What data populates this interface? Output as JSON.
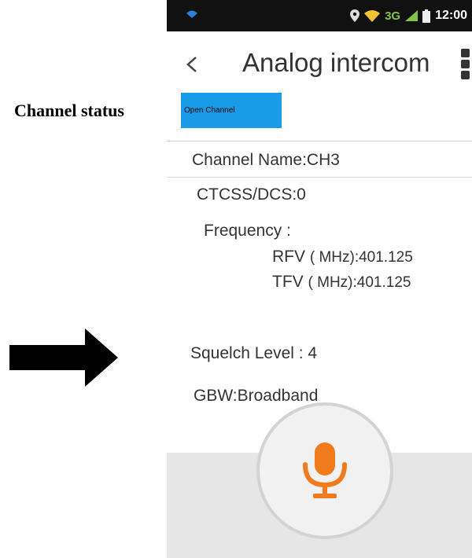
{
  "annotation": {
    "label": "Channel status"
  },
  "statusbar": {
    "network": "3G",
    "time": "12:00"
  },
  "header": {
    "back_icon": "chevron-left-icon",
    "title": "Analog intercom",
    "overflow_icon": "more-vert-icon"
  },
  "channel": {
    "open_button_label": "Open Channel",
    "name_line": "Channel Name:CH3",
    "ctcss_line": "CTCSS/DCS:0",
    "frequency_label": "Frequency :",
    "rfv_label": "RFV",
    "rfv_value": "( MHz):401.125",
    "tfv_label": "TFV",
    "tfv_value": "( MHz):401.125",
    "squelch_line": "Squelch Level : 4",
    "gbw_line": "GBW:Broadband"
  },
  "mic": {
    "icon": "microphone-icon",
    "accent_color": "#f07b1d"
  },
  "colors": {
    "button_blue": "#1a9be8",
    "annotation_red": "#d9363e"
  }
}
